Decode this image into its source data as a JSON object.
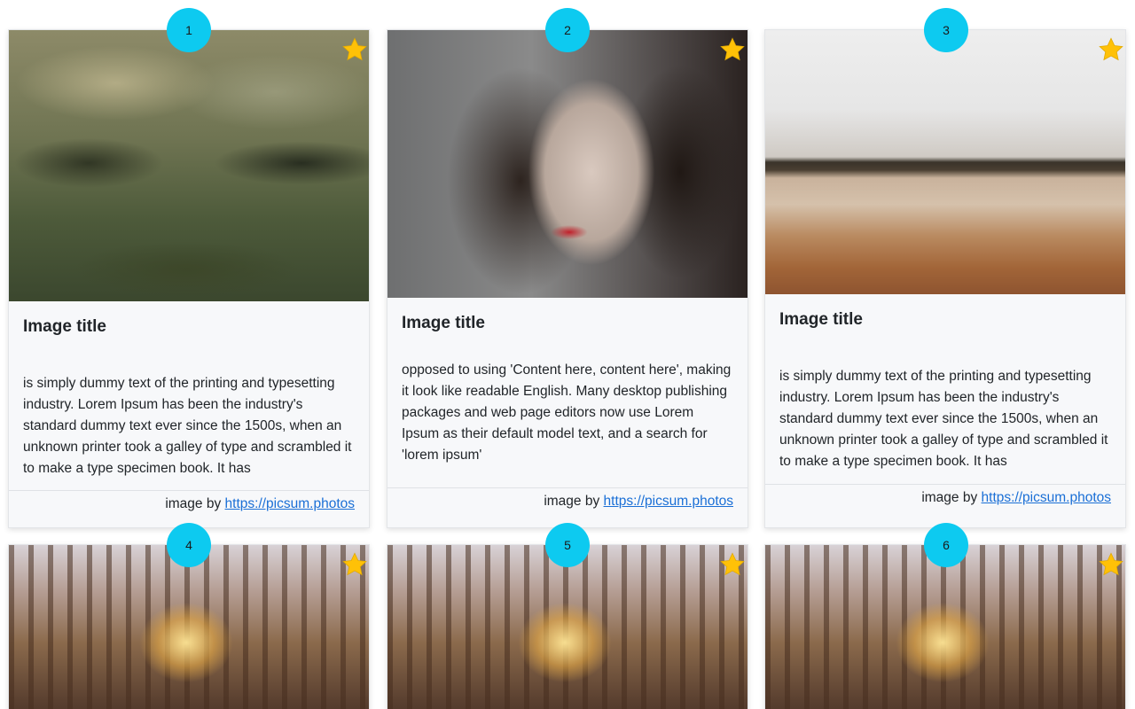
{
  "colors": {
    "badge_bg": "#0dcaf0",
    "star": "#ffc107",
    "link": "#1a6fd6",
    "card_bg": "#f7f8fa"
  },
  "cards": [
    {
      "number": "1",
      "favorite_icon": "star-icon",
      "image_subject": "moss-texture",
      "title": "Image title",
      "text": "is simply dummy text of the printing and typesetting industry. Lorem Ipsum has been the industry's standard dummy text ever since the 1500s, when an unknown printer took a galley of type and scrambled it to make a type specimen book. It has",
      "credit_prefix": "image by",
      "credit_link": "https://picsum.photos"
    },
    {
      "number": "2",
      "favorite_icon": "star-icon",
      "image_subject": "portrait",
      "title": "Image title",
      "text": "opposed to using 'Content here, content here', making it look like readable English. Many desktop publishing packages and web page editors now use Lorem Ipsum as their default model text, and a search for 'lorem ipsum'",
      "credit_prefix": "image by",
      "credit_link": "https://picsum.photos"
    },
    {
      "number": "3",
      "favorite_icon": "star-icon",
      "image_subject": "beach",
      "title": "Image title",
      "text": "is simply dummy text of the printing and typesetting industry. Lorem Ipsum has been the industry's standard dummy text ever since the 1500s, when an unknown printer took a galley of type and scrambled it to make a type specimen book. It has",
      "credit_prefix": "image by",
      "credit_link": "https://picsum.photos"
    },
    {
      "number": "4",
      "favorite_icon": "star-icon",
      "image_subject": "forest-sunset"
    },
    {
      "number": "5",
      "favorite_icon": "star-icon",
      "image_subject": "forest-sunset"
    },
    {
      "number": "6",
      "favorite_icon": "star-icon",
      "image_subject": "forest-sunset"
    }
  ]
}
